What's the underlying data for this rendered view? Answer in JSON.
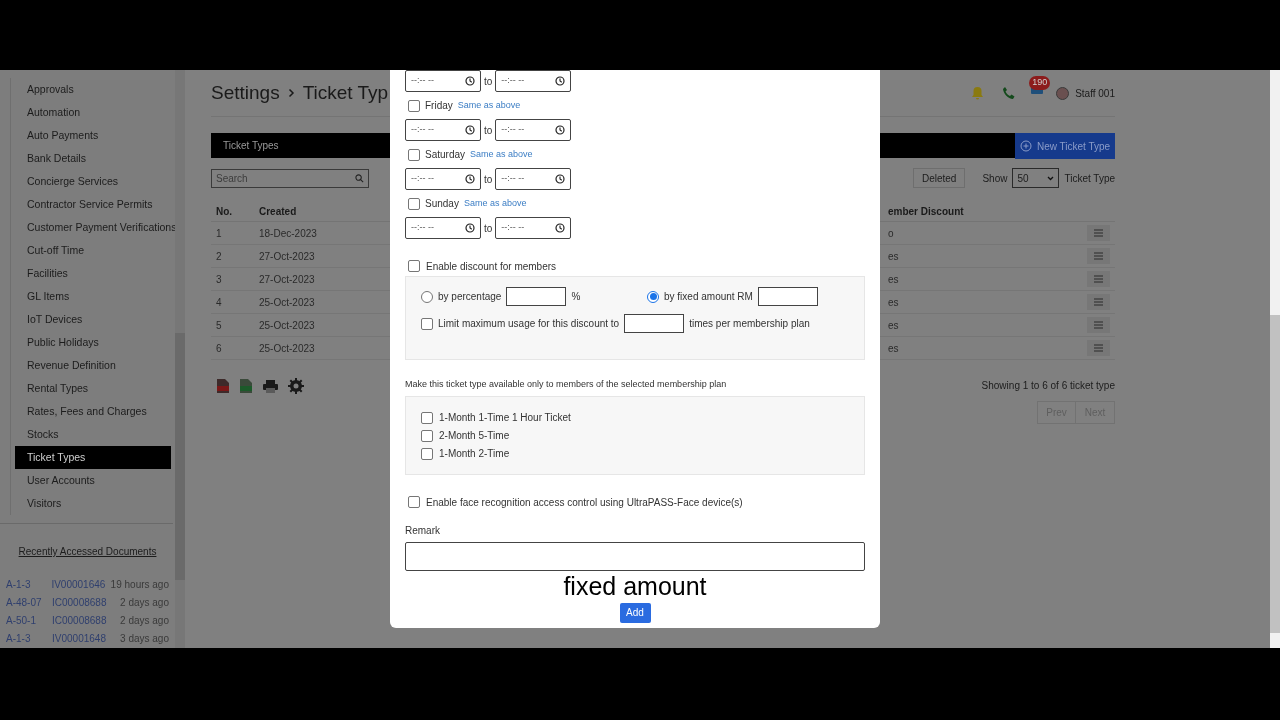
{
  "header": {
    "title": "Settings",
    "breadcrumb": "Ticket Typ",
    "notification_count": "190",
    "user": "Staff 001"
  },
  "sidebar": {
    "items": [
      {
        "label": "Approvals",
        "selected": false
      },
      {
        "label": "Automation",
        "selected": false
      },
      {
        "label": "Auto Payments",
        "selected": false
      },
      {
        "label": "Bank Details",
        "selected": false
      },
      {
        "label": "Concierge Services",
        "selected": false
      },
      {
        "label": "Contractor Service Permits",
        "selected": false
      },
      {
        "label": "Customer Payment Verifications",
        "selected": false
      },
      {
        "label": "Cut-off Time",
        "selected": false
      },
      {
        "label": "Facilities",
        "selected": false
      },
      {
        "label": "GL Items",
        "selected": false
      },
      {
        "label": "IoT Devices",
        "selected": false
      },
      {
        "label": "Public Holidays",
        "selected": false
      },
      {
        "label": "Revenue Definition",
        "selected": false
      },
      {
        "label": "Rental Types",
        "selected": false
      },
      {
        "label": "Rates, Fees and Charges",
        "selected": false
      },
      {
        "label": "Stocks",
        "selected": false
      },
      {
        "label": "Ticket Types",
        "selected": true
      },
      {
        "label": "User Accounts",
        "selected": false
      },
      {
        "label": "Visitors",
        "selected": false
      }
    ],
    "recent_title": "Recently Accessed Documents",
    "recent": [
      {
        "unit": "A-1-3",
        "doc": "IV00001646",
        "time": "19 hours ago"
      },
      {
        "unit": "A-48-07",
        "doc": "IC00008688",
        "time": "2 days ago"
      },
      {
        "unit": "A-50-1",
        "doc": "IC00008688",
        "time": "2 days ago"
      },
      {
        "unit": "A-1-3",
        "doc": "IV00001648",
        "time": "3 days ago"
      }
    ]
  },
  "panel": {
    "title": "Ticket Types",
    "new_button": "New Ticket Type",
    "search_placeholder": "Search",
    "deleted_button": "Deleted",
    "show_label": "Show",
    "show_value": "50",
    "show_suffix": "Ticket Type",
    "columns": [
      "No.",
      "Created",
      "ember Discount"
    ],
    "rows": [
      {
        "no": "1",
        "created": "18-Dec-2023",
        "discount": "o"
      },
      {
        "no": "2",
        "created": "27-Oct-2023",
        "discount": "es"
      },
      {
        "no": "3",
        "created": "27-Oct-2023",
        "discount": "es"
      },
      {
        "no": "4",
        "created": "25-Oct-2023",
        "discount": "es"
      },
      {
        "no": "5",
        "created": "25-Oct-2023",
        "discount": "es"
      },
      {
        "no": "6",
        "created": "25-Oct-2023",
        "discount": "es"
      }
    ],
    "showing": "Showing 1 to 6 of 6 ticket type",
    "prev": "Prev",
    "next": "Next"
  },
  "modal": {
    "first_row": {
      "from": "--:-- --",
      "to_label": "to",
      "to": "--:-- --"
    },
    "days": [
      {
        "label": "Friday",
        "checked": false,
        "link": "Same as above",
        "from": "--:-- --",
        "to_label": "to",
        "to": "--:-- --"
      },
      {
        "label": "Saturday",
        "checked": false,
        "link": "Same as above",
        "from": "--:-- --",
        "to_label": "to",
        "to": "--:-- --"
      },
      {
        "label": "Sunday",
        "checked": false,
        "link": "Same as above",
        "from": "--:-- --",
        "to_label": "to",
        "to": "--:-- --"
      }
    ],
    "discount": {
      "label": "Enable discount for members",
      "checked": false,
      "options": [
        {
          "label": "by percentage",
          "selected": false,
          "suffix": "%"
        },
        {
          "label": "by fixed amount RM",
          "selected": true
        }
      ],
      "limit": {
        "label": "Limit maximum usage for this discount to",
        "checked": false,
        "suffix": "times per membership plan"
      }
    },
    "plans_label": "Make this ticket type available only to members of the selected membership plan",
    "plans": [
      {
        "label": "1-Month 1-Time 1 Hour Ticket",
        "checked": false
      },
      {
        "label": "2-Month 5-Time",
        "checked": false
      },
      {
        "label": "1-Month 2-Time",
        "checked": false
      }
    ],
    "face": {
      "label": "Enable face recognition access control using UltraPASS-Face device(s)",
      "checked": false
    },
    "remark_label": "Remark",
    "add_button": "Add"
  },
  "caption": "fixed amount"
}
